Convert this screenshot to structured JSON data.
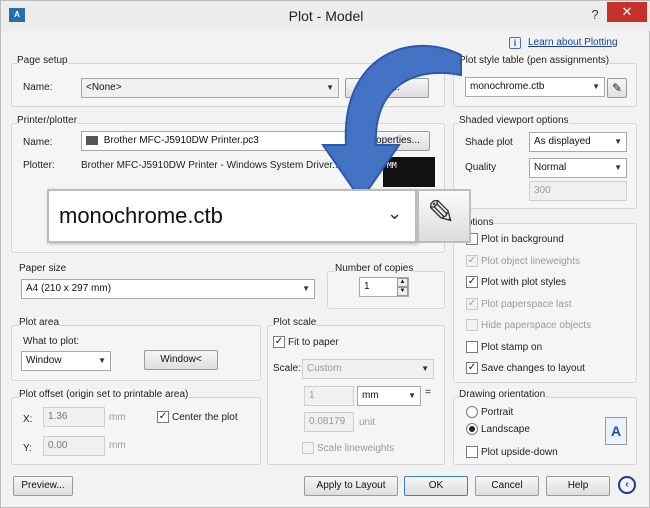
{
  "window": {
    "title": "Plot - Model",
    "app_icon": "autocad-icon",
    "help_button": "?",
    "close_button": "✕"
  },
  "info": {
    "link": "Learn about Plotting"
  },
  "page_setup": {
    "title": "Page setup",
    "name_label": "Name:",
    "name_value": "<None>",
    "add_label": "Add..."
  },
  "printer": {
    "title": "Printer/plotter",
    "name_label": "Name:",
    "name_value": "Brother MFC-J5910DW Printer.pc3",
    "properties_label": "Properties...",
    "plotter_label": "Plotter:",
    "plotter_value": "Brother MFC-J5910DW Printer - Windows System Driver...",
    "preview_size": "MM"
  },
  "paper_size": {
    "title": "Paper size",
    "value": "A4 (210 x 297 mm)"
  },
  "copies": {
    "title": "Number of copies",
    "value": "1"
  },
  "plot_area": {
    "title": "Plot area",
    "what_label": "What to plot:",
    "value": "Window",
    "window_button": "Window<"
  },
  "plot_offset": {
    "title": "Plot offset (origin set to printable area)",
    "x_label": "X:",
    "x_value": "1.36",
    "y_label": "Y:",
    "y_value": "0.00",
    "unit": "mm",
    "center_label": "Center the plot"
  },
  "plot_scale": {
    "title": "Plot scale",
    "fit_label": "Fit to paper",
    "scale_label": "Scale:",
    "scale_value": "Custom",
    "num_value": "1",
    "unit_value": "mm",
    "equals": "=",
    "den_value": "0.08179",
    "den_unit": "unit",
    "lineweights_label": "Scale lineweights"
  },
  "plot_style": {
    "title": "Plot style table (pen assignments)",
    "value": "monochrome.ctb"
  },
  "shaded": {
    "title": "Shaded viewport options",
    "shade_label": "Shade plot",
    "shade_value": "As displayed",
    "quality_label": "Quality",
    "quality_value": "Normal",
    "dpi_value": "300"
  },
  "options": {
    "title": "Options",
    "items": [
      {
        "label": "Plot in background",
        "checked": false,
        "enabled": true
      },
      {
        "label": "Plot object lineweights",
        "checked": true,
        "enabled": false
      },
      {
        "label": "Plot with plot styles",
        "checked": true,
        "enabled": true
      },
      {
        "label": "Plot paperspace last",
        "checked": true,
        "enabled": false
      },
      {
        "label": "Hide paperspace objects",
        "checked": false,
        "enabled": false
      },
      {
        "label": "Plot stamp on",
        "checked": false,
        "enabled": true
      },
      {
        "label": "Save changes to layout",
        "checked": true,
        "enabled": true
      }
    ]
  },
  "orientation": {
    "title": "Drawing orientation",
    "portrait": "Portrait",
    "landscape": "Landscape",
    "upside_down": "Plot upside-down",
    "selected": "Landscape"
  },
  "zoom_callout": {
    "value": "monochrome.ctb"
  },
  "buttons": {
    "preview": "Preview...",
    "apply": "Apply to Layout",
    "ok": "OK",
    "cancel": "Cancel",
    "help": "Help"
  },
  "colors": {
    "arrow": "#3f6fbf",
    "close": "#c7312b",
    "link": "#1a3fb0"
  }
}
